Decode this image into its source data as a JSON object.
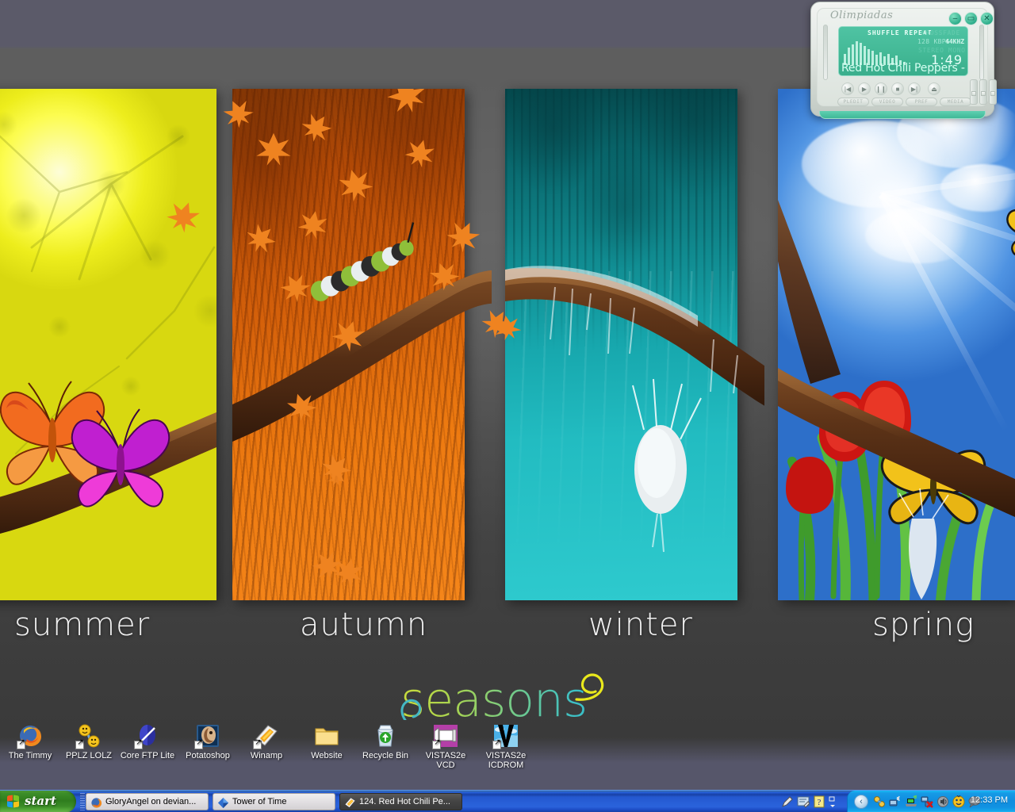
{
  "desktop": {
    "wallpaper_title": "seasons",
    "panels": [
      {
        "id": "summer",
        "label": "summer",
        "accent": "#e8e810"
      },
      {
        "id": "autumn",
        "label": "autumn",
        "accent": "#ed7a10"
      },
      {
        "id": "winter",
        "label": "winter",
        "accent": "#17a7ad"
      },
      {
        "id": "spring",
        "label": "spring",
        "accent": "#3e84d8"
      }
    ],
    "background_top_color": "#5b5a69",
    "background_mid_color": "#5e5e5e",
    "background_bottom_color": "#56566a"
  },
  "icons": [
    {
      "name": "The Timmy",
      "icon": "firefox-icon",
      "shortcut": true
    },
    {
      "name": "PPLZ LOLZ",
      "icon": "smileys-icon",
      "shortcut": true
    },
    {
      "name": "Core FTP Lite",
      "icon": "coreftp-icon",
      "shortcut": true
    },
    {
      "name": "Potatoshop",
      "icon": "photoshop-icon",
      "shortcut": true
    },
    {
      "name": "Winamp",
      "icon": "winamp-icon",
      "shortcut": true
    },
    {
      "name": "Website",
      "icon": "folder-icon",
      "shortcut": false
    },
    {
      "name": "Recycle Bin",
      "icon": "recycle-bin-icon",
      "shortcut": false
    },
    {
      "name": "VISTAS2e VCD",
      "icon": "vcd-drive-icon",
      "shortcut": true
    },
    {
      "name": "VISTAS2e ICDROM",
      "icon": "cdrom-drive-icon",
      "shortcut": true
    }
  ],
  "winamp": {
    "skin_title": "Olimpiadas",
    "titlebar_buttons": [
      "minimize",
      "shade",
      "close"
    ],
    "display": {
      "shuffle": "SHUFFLE",
      "repeat": "REPEAT",
      "crossfade": "CROSSFADE",
      "bitrate": "128",
      "bitrate_unit": "KBPS",
      "samplerate": "44",
      "samplerate_unit": "KHZ",
      "stereo": "STEREO",
      "mono": "MONO",
      "time": "1:49",
      "track": "Red Hot Chili Peppers -"
    },
    "transport": [
      "prev",
      "play",
      "pause",
      "stop",
      "next",
      "eject"
    ],
    "buttons": [
      "PLEDIT",
      "VIDEO",
      "PREF",
      "MEDIA"
    ]
  },
  "taskbar": {
    "start_label": "start",
    "tasks": [
      {
        "title": "GloryAngel on devian...",
        "icon": "firefox-icon",
        "active": false
      },
      {
        "title": "Tower of Time",
        "icon": "diamond-icon",
        "active": false
      },
      {
        "title": "124. Red Hot Chili Pe...",
        "icon": "winamp-icon",
        "active": true
      }
    ],
    "quick_icons": [
      "pen-icon",
      "tablet-icon",
      "help-icon",
      "overflow-icon"
    ],
    "tray": {
      "expand_arrow": "‹",
      "icons": [
        "network-users-icon",
        "wireless-icon",
        "lan-monitor-icon",
        "network-error-icon",
        "volume-icon",
        "messenger-icon",
        "speech-bubble-icon"
      ],
      "clock": "12:33 PM"
    }
  }
}
